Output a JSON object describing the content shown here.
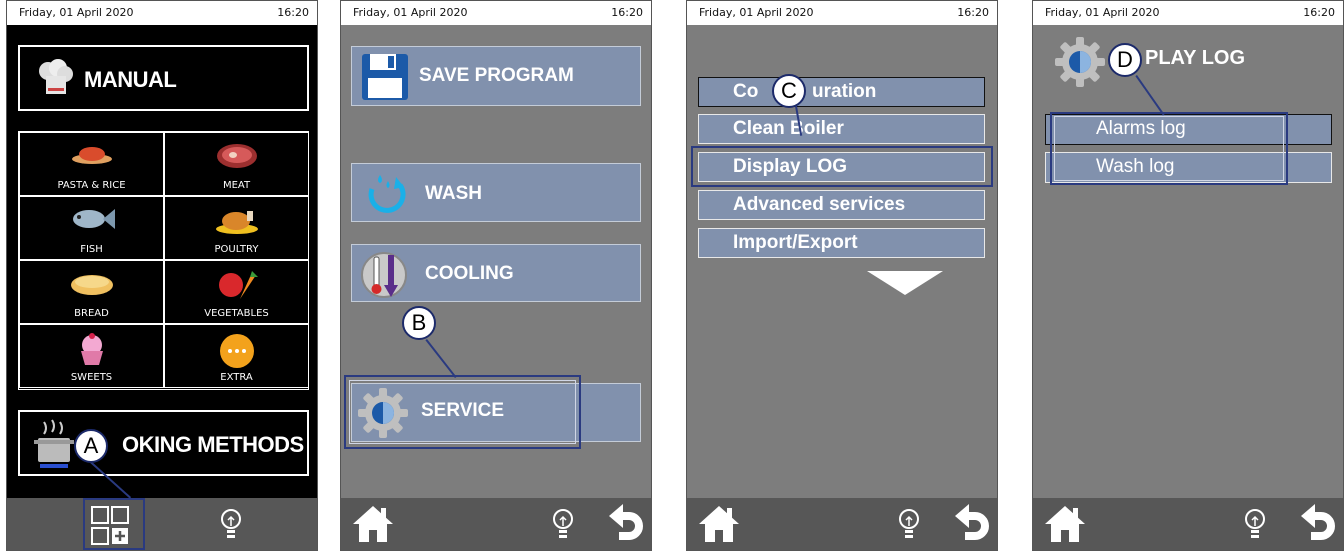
{
  "status": {
    "date": "Friday, 01 April 2020",
    "time": "16:20"
  },
  "screen1": {
    "manual_label": "MANUAL",
    "categories": [
      {
        "label": "PASTA & RICE"
      },
      {
        "label": "MEAT"
      },
      {
        "label": "FISH"
      },
      {
        "label": "POULTRY"
      },
      {
        "label": "BREAD"
      },
      {
        "label": "VEGETABLES"
      },
      {
        "label": "SWEETS"
      },
      {
        "label": "EXTRA"
      }
    ],
    "cooking_methods_label": "OKING METHODS",
    "callout": "A"
  },
  "screen2": {
    "save_program": "SAVE PROGRAM",
    "wash": "WASH",
    "cooling": "COOLING",
    "service": "SERVICE",
    "callout": "B"
  },
  "screen3": {
    "items": [
      {
        "label": "Co"
      },
      {
        "label": "Clean Boiler"
      },
      {
        "label": "Display LOG"
      },
      {
        "label": "Advanced services"
      },
      {
        "label": "Import/Export"
      }
    ],
    "config_suffix": "uration",
    "callout": "C"
  },
  "screen4": {
    "title": "PLAY LOG",
    "items": [
      {
        "label": "Alarms log"
      },
      {
        "label": "Wash log"
      }
    ],
    "callout": "D"
  },
  "colors": {
    "button_blue": "#8191ad",
    "screen_gray": "#7d7d7d",
    "callout_border": "#2a3a80"
  }
}
